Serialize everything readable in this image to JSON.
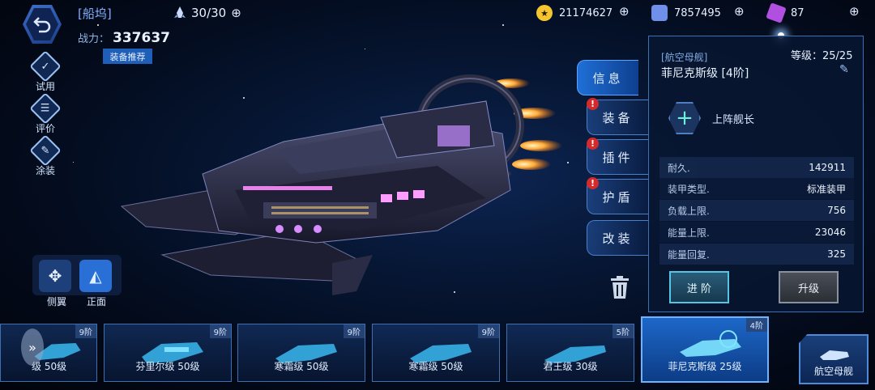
{
  "header": {
    "title": "[船坞]",
    "fleet_count": "30/30",
    "power_label": "战力：",
    "power_value": "337637",
    "recommend_label": "装备推荐",
    "resources": [
      {
        "icon": "gold-coin-icon",
        "value": "21174627",
        "color": "#f2c531"
      },
      {
        "icon": "crystal-ore-icon",
        "value": "7857495",
        "color": "#6f8fe8"
      },
      {
        "icon": "purple-gem-icon",
        "value": "87",
        "color": "#b04fe0"
      }
    ],
    "plus_symbol": "⊕"
  },
  "side_menu": [
    {
      "label": "试用",
      "icon": "trial-icon"
    },
    {
      "label": "评价",
      "icon": "review-icon"
    },
    {
      "label": "涂装",
      "icon": "paint-icon"
    }
  ],
  "view_modes": [
    {
      "label": "侧翼",
      "icon": "move-arrows-icon"
    },
    {
      "label": "正面",
      "icon": "front-view-icon"
    }
  ],
  "tabs": [
    {
      "label": "信息",
      "active": true,
      "alert": false
    },
    {
      "label": "装备",
      "active": false,
      "alert": true
    },
    {
      "label": "插件",
      "active": false,
      "alert": true
    },
    {
      "label": "护盾",
      "active": false,
      "alert": true
    },
    {
      "label": "改装",
      "active": false,
      "alert": false
    }
  ],
  "panel": {
    "ship_type": "[航空母舰]",
    "ship_name": "菲尼克斯级 [4阶]",
    "level": "等级：25/25",
    "captain_label": "上阵舰长",
    "stats": [
      {
        "name": "耐久.",
        "value": "142911"
      },
      {
        "name": "装甲类型.",
        "value": "标准装甲"
      },
      {
        "name": "负载上限.",
        "value": "756"
      },
      {
        "name": "能量上限.",
        "value": "23046"
      },
      {
        "name": "能量回复.",
        "value": "325"
      }
    ],
    "advance_label": "进 阶",
    "upgrade_label": "升级"
  },
  "ship_list": [
    {
      "name": "级 50级",
      "tier": "9阶",
      "selected": false
    },
    {
      "name": "芬里尔级 50级",
      "tier": "9阶",
      "selected": false
    },
    {
      "name": "寒霜级 50级",
      "tier": "9阶",
      "selected": false
    },
    {
      "name": "寒霜级 50级",
      "tier": "9阶",
      "selected": false
    },
    {
      "name": "君王级 30级",
      "tier": "5阶",
      "selected": false
    },
    {
      "name": "菲尼克斯级 25级",
      "tier": "4阶",
      "selected": true
    }
  ],
  "category_button": {
    "label": "航空母舰"
  }
}
